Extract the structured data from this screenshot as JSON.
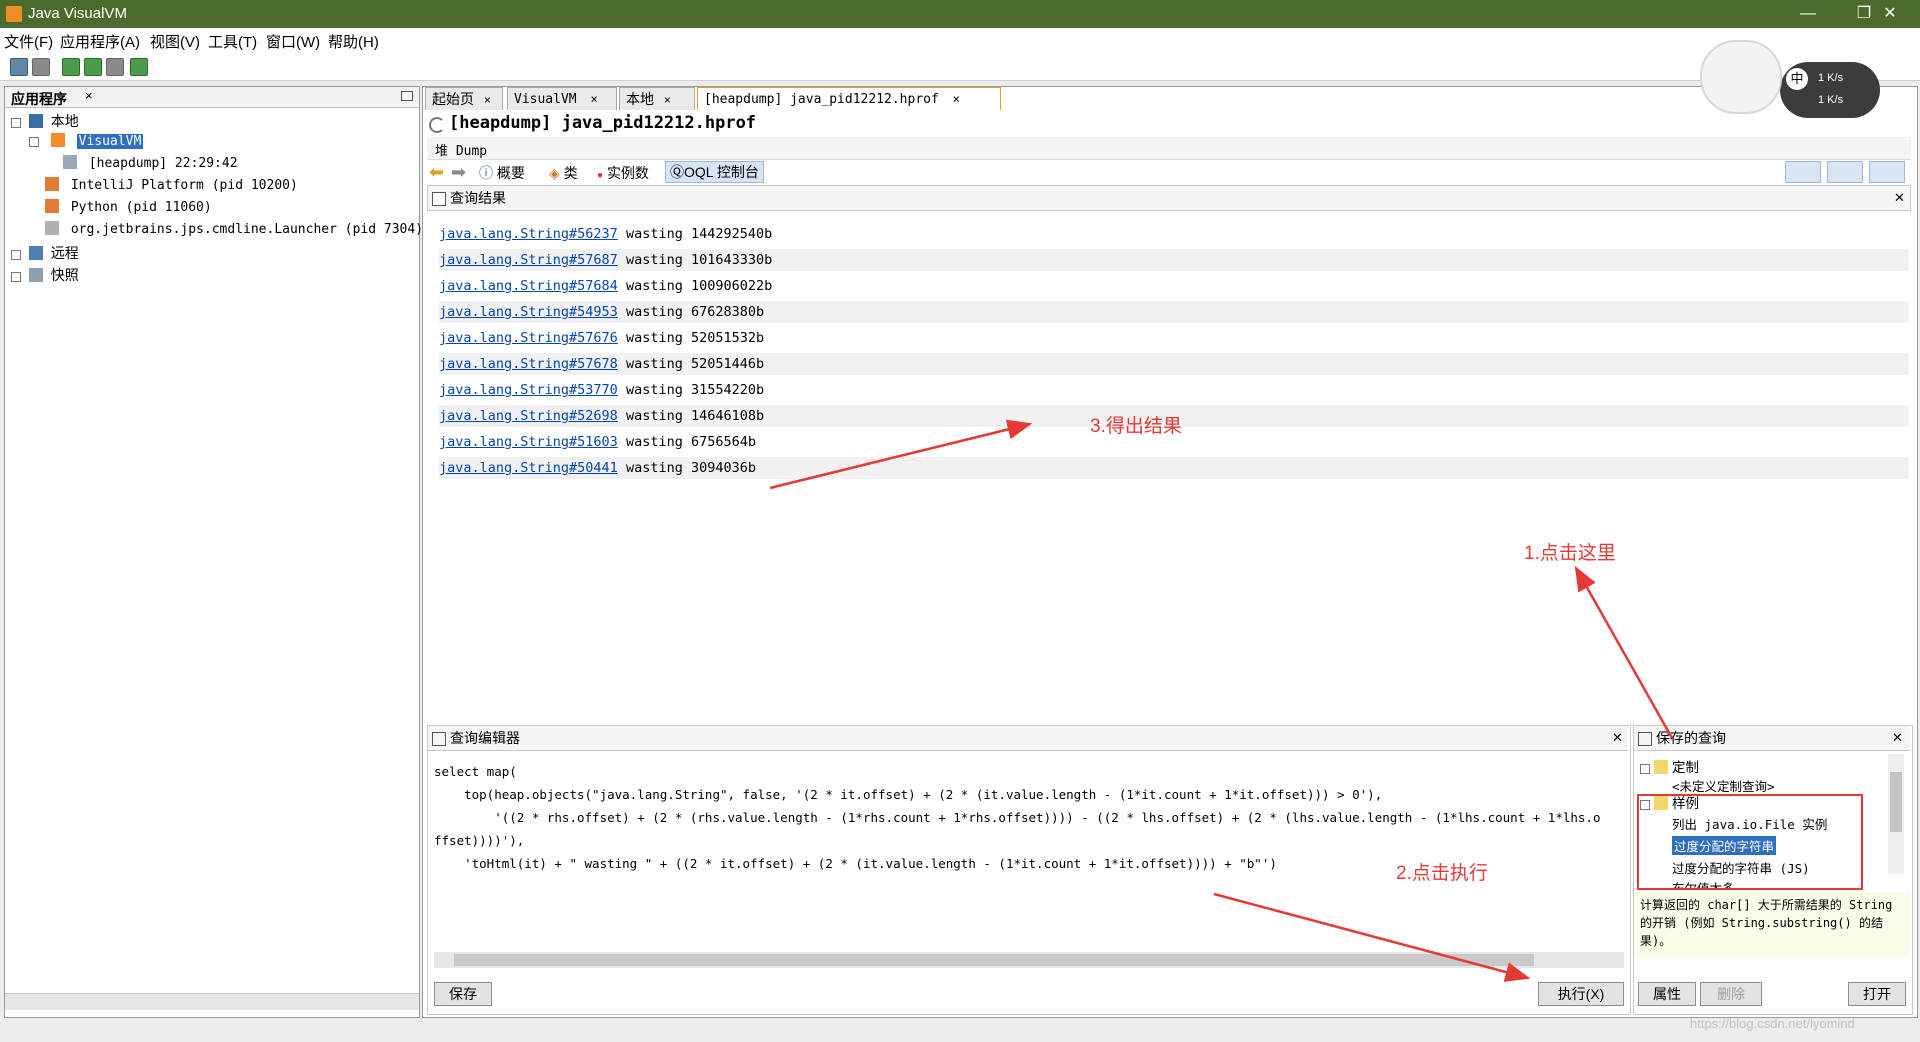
{
  "window": {
    "title": "Java VisualVM",
    "minimize": "—",
    "restore": "❐",
    "close": "✕"
  },
  "menu": [
    "文件(F)",
    "应用程序(A)",
    "视图(V)",
    "工具(T)",
    "窗口(W)",
    "帮助(H)"
  ],
  "left_panel": {
    "tab": "应用程序",
    "tab_close": "×",
    "tree": {
      "local": "本地",
      "visualvm": "VisualVM",
      "heapdump": "[heapdump] 22:29:42",
      "intellij": "IntelliJ Platform (pid 10200)",
      "python": "Python (pid 11060)",
      "launcher": "org.jetbrains.jps.cmdline.Launcher (pid 7304)",
      "remote": "远程",
      "snapshot": "快照"
    }
  },
  "doc_tabs": [
    "起始页",
    "VisualVM",
    "本地",
    "[heapdump] java_pid12212.hprof"
  ],
  "tab_close": "×",
  "heap": {
    "title": "[heapdump] java_pid12212.hprof",
    "subtitle": "堆 Dump",
    "nav": {
      "summary": "概要",
      "classes": "类",
      "instances": "实例数",
      "oql": "OQL 控制台"
    },
    "results_title": "查询结果",
    "results": [
      {
        "link": "java.lang.String#56237",
        "text": "wasting 144292540b"
      },
      {
        "link": "java.lang.String#57687",
        "text": "wasting 101643330b"
      },
      {
        "link": "java.lang.String#57684",
        "text": "wasting 100906022b"
      },
      {
        "link": "java.lang.String#54953",
        "text": "wasting 67628380b"
      },
      {
        "link": "java.lang.String#57676",
        "text": "wasting 52051532b"
      },
      {
        "link": "java.lang.String#57678",
        "text": "wasting 52051446b"
      },
      {
        "link": "java.lang.String#53770",
        "text": "wasting 31554220b"
      },
      {
        "link": "java.lang.String#52698",
        "text": "wasting 14646108b"
      },
      {
        "link": "java.lang.String#51603",
        "text": "wasting 6756564b"
      },
      {
        "link": "java.lang.String#50441",
        "text": "wasting 3094036b"
      }
    ]
  },
  "editor": {
    "title": "查询编辑器",
    "lines": [
      "select map(",
      "    top(heap.objects(\"java.lang.String\", false, '(2 * it.offset) + (2 * (it.value.length - (1*it.count + 1*it.offset))) > 0'),",
      "        '((2 * rhs.offset) + (2 * (rhs.value.length - (1*rhs.count + 1*rhs.offset)))) - ((2 * lhs.offset) + (2 * (lhs.value.length - (1*lhs.count + 1*lhs.o",
      "ffset))))'),",
      "    'toHtml(it) + \" wasting \" + ((2 * it.offset) + (2 * (it.value.length - (1*it.count + 1*it.offset)))) + \"b\"')"
    ],
    "save": "保存",
    "execute": "执行(X)"
  },
  "saved": {
    "title": "保存的查询",
    "custom": "定制",
    "custom_empty": "<未定义定制查询>",
    "samples": "样例",
    "item1": "列出 java.io.File 实例",
    "item2": "过度分配的字符串",
    "item3": "过度分配的字符串 (JS)",
    "item4": "布尔值太多",
    "description": "计算返回的 char[] 大于所需结果的 String 的开销 (例如 String.substring() 的结果)。",
    "props": "属性",
    "delete": "删除",
    "open": "打开"
  },
  "annotations": {
    "step1": "1.点击这里",
    "step2": "2.点击执行",
    "step3": "3.得出结果"
  },
  "overlay": {
    "ime": "中",
    "speed1": "1 K/s",
    "speed2": "1 K/s"
  },
  "watermark": "https://blog.csdn.net/lyomind",
  "colors": {
    "titlebar": "#4b6a2e",
    "selection": "#2f6fbf",
    "annotation": "#e53935",
    "link": "#0645ad"
  }
}
